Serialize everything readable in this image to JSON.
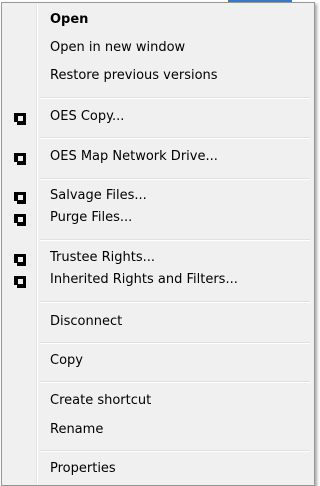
{
  "menu": {
    "items": [
      {
        "label": "Open",
        "bold": true
      },
      {
        "label": "Open in new window"
      },
      {
        "label": "Restore previous versions"
      },
      {
        "label": "OES Copy...",
        "icon": "novell-oes-icon"
      },
      {
        "label": "OES Map Network Drive...",
        "icon": "novell-oes-icon"
      },
      {
        "label": "Salvage Files...",
        "icon": "novell-oes-icon"
      },
      {
        "label": "Purge Files...",
        "icon": "novell-oes-icon"
      },
      {
        "label": "Trustee Rights...",
        "icon": "novell-oes-icon"
      },
      {
        "label": "Inherited Rights and Filters...",
        "icon": "novell-oes-icon"
      },
      {
        "label": "Disconnect"
      },
      {
        "label": "Copy"
      },
      {
        "label": "Create shortcut"
      },
      {
        "label": "Rename"
      },
      {
        "label": "Properties"
      }
    ]
  },
  "colors": {
    "menu_background": "#f0f0f0",
    "border": "#979797",
    "icon": "#000000",
    "accent": "#3b79c9"
  }
}
